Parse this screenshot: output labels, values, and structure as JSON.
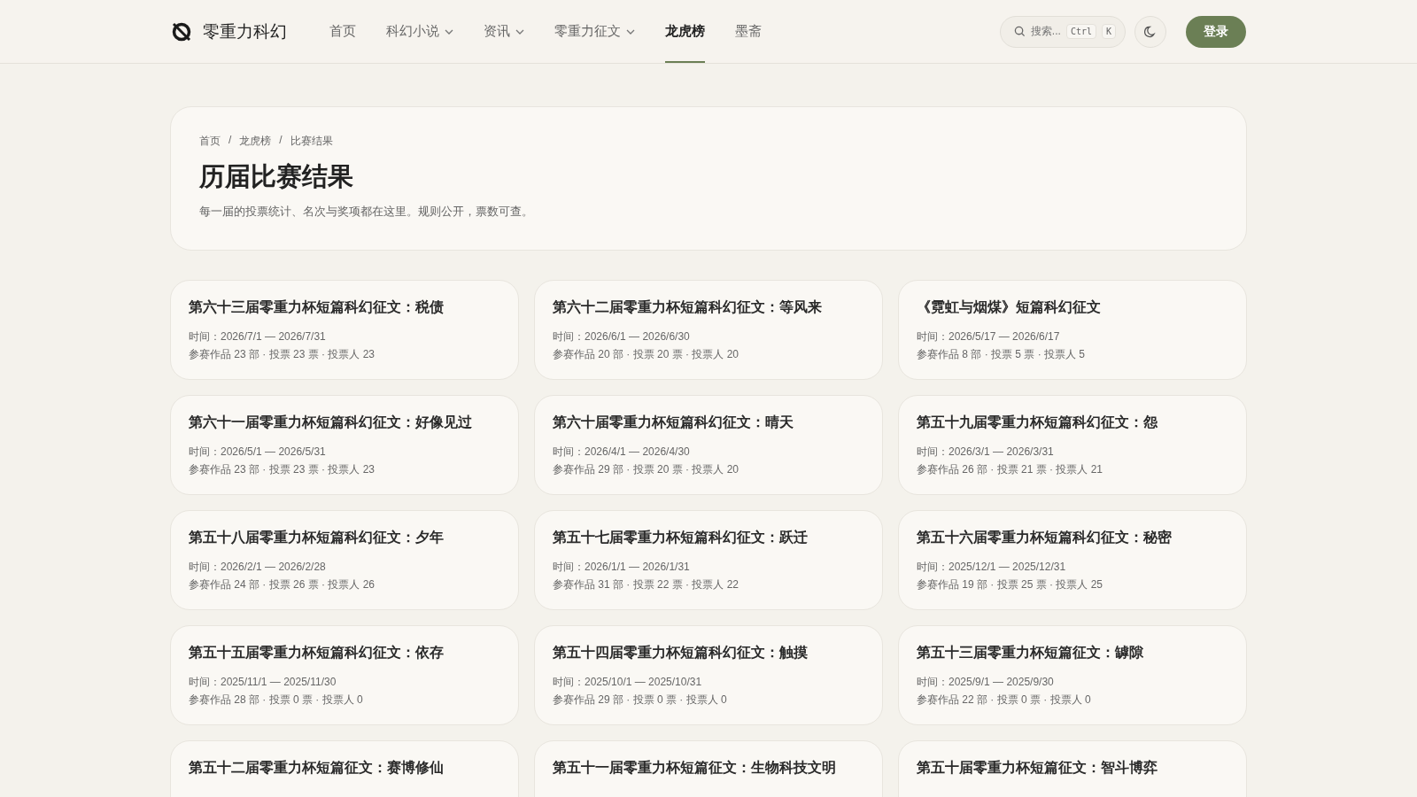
{
  "header": {
    "logo_text": "零重力科幻",
    "nav": [
      {
        "label": "首页",
        "dropdown": false,
        "selected": false
      },
      {
        "label": "科幻小说",
        "dropdown": true,
        "selected": false
      },
      {
        "label": "资讯",
        "dropdown": true,
        "selected": false
      },
      {
        "label": "零重力征文",
        "dropdown": true,
        "selected": false
      },
      {
        "label": "龙虎榜",
        "dropdown": false,
        "selected": true
      },
      {
        "label": "墨斋",
        "dropdown": false,
        "selected": false
      }
    ],
    "search": {
      "placeholder": "搜索...",
      "keys": [
        "Ctrl",
        "K"
      ]
    },
    "login": "登录"
  },
  "hero": {
    "breadcrumb": [
      "首页",
      "龙虎榜",
      "比赛结果"
    ],
    "separator": "/",
    "title": "历届比赛结果",
    "subtitle": "每一届的投票统计、名次与奖项都在这里。规则公开，票数可查。"
  },
  "contests": [
    {
      "title": "第六十三届零重力杯短篇科幻征文：税债",
      "date": "时间：2026/7/1 — 2026/7/31",
      "stats": "参赛作品 23 部 · 投票 23 票 · 投票人 23"
    },
    {
      "title": "第六十二届零重力杯短篇科幻征文：等风来",
      "date": "时间：2026/6/1 — 2026/6/30",
      "stats": "参赛作品 20 部 · 投票 20 票 · 投票人 20"
    },
    {
      "title": "《霓虹与烟煤》短篇科幻征文",
      "date": "时间：2026/5/17 — 2026/6/17",
      "stats": "参赛作品 8 部 · 投票 5 票 · 投票人 5"
    },
    {
      "title": "第六十一届零重力杯短篇科幻征文：好像见过",
      "date": "时间：2026/5/1 — 2026/5/31",
      "stats": "参赛作品 23 部 · 投票 23 票 · 投票人 23"
    },
    {
      "title": "第六十届零重力杯短篇科幻征文：晴天",
      "date": "时间：2026/4/1 — 2026/4/30",
      "stats": "参赛作品 29 部 · 投票 20 票 · 投票人 20"
    },
    {
      "title": "第五十九届零重力杯短篇科幻征文：怨",
      "date": "时间：2026/3/1 — 2026/3/31",
      "stats": "参赛作品 26 部 · 投票 21 票 · 投票人 21"
    },
    {
      "title": "第五十八届零重力杯短篇科幻征文：夕年",
      "date": "时间：2026/2/1 — 2026/2/28",
      "stats": "参赛作品 24 部 · 投票 26 票 · 投票人 26"
    },
    {
      "title": "第五十七届零重力杯短篇科幻征文：跃迁",
      "date": "时间：2026/1/1 — 2026/1/31",
      "stats": "参赛作品 31 部 · 投票 22 票 · 投票人 22"
    },
    {
      "title": "第五十六届零重力杯短篇科幻征文：秘密",
      "date": "时间：2025/12/1 — 2025/12/31",
      "stats": "参赛作品 19 部 · 投票 25 票 · 投票人 25"
    },
    {
      "title": "第五十五届零重力杯短篇科幻征文：依存",
      "date": "时间：2025/11/1 — 2025/11/30",
      "stats": "参赛作品 28 部 · 投票 0 票 · 投票人 0"
    },
    {
      "title": "第五十四届零重力杯短篇科幻征文：触摸",
      "date": "时间：2025/10/1 — 2025/10/31",
      "stats": "参赛作品 29 部 · 投票 0 票 · 投票人 0"
    },
    {
      "title": "第五十三届零重力杯短篇征文：罅隙",
      "date": "时间：2025/9/1 — 2025/9/30",
      "stats": "参赛作品 22 部 · 投票 0 票 · 投票人 0"
    },
    {
      "title": "第五十二届零重力杯短篇征文：赛博修仙"
    },
    {
      "title": "第五十一届零重力杯短篇征文：生物科技文明"
    },
    {
      "title": "第五十届零重力杯短篇征文：智斗博弈"
    }
  ]
}
